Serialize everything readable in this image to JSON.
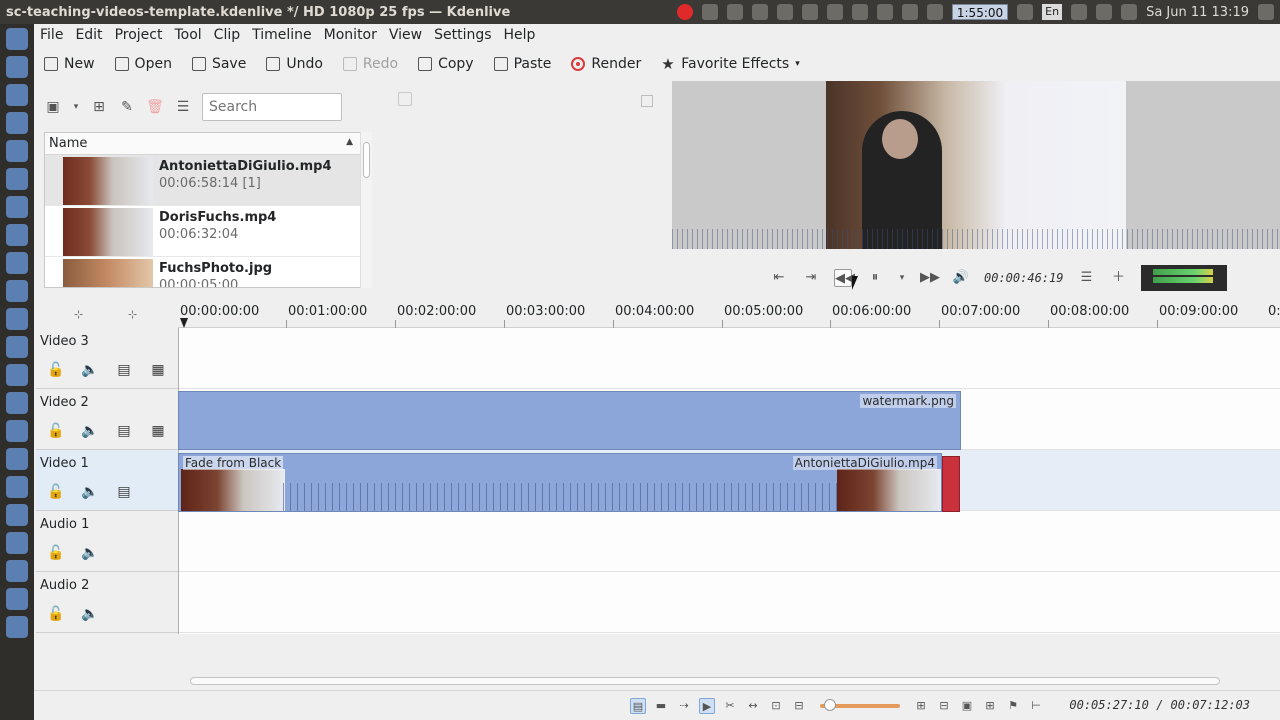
{
  "window": {
    "title": "sc-teaching-videos-template.kdenlive */ HD 1080p 25 fps — Kdenlive"
  },
  "system_tray": {
    "clock_box": "1:55:00",
    "keyboard_lang": "En",
    "datetime": "Sa Jun 11 13:19"
  },
  "menu": [
    "File",
    "Edit",
    "Project",
    "Tool",
    "Clip",
    "Timeline",
    "Monitor",
    "View",
    "Settings",
    "Help"
  ],
  "toolbar": {
    "new": "New",
    "open": "Open",
    "save": "Save",
    "undo": "Undo",
    "redo": "Redo",
    "copy": "Copy",
    "paste": "Paste",
    "render": "Render",
    "favorite_effects": "Favorite Effects"
  },
  "bin": {
    "search_placeholder": "Search",
    "column_name": "Name",
    "clips": [
      {
        "name": "AntoniettaDiGiulio.mp4",
        "duration": "00:06:58:14",
        "count": "[1]"
      },
      {
        "name": "DorisFuchs.mp4",
        "duration": "00:06:32:04",
        "count": ""
      },
      {
        "name": "FuchsPhoto.jpg",
        "duration": "00:00:05:00",
        "count": ""
      }
    ]
  },
  "monitor": {
    "timecode": "00:00:46:19"
  },
  "ruler": {
    "ticks": [
      "00:00:00:00",
      "00:01:00:00",
      "00:02:00:00",
      "00:03:00:00",
      "00:04:00:00",
      "00:05:00:00",
      "00:06:00:00",
      "00:07:00:00",
      "00:08:00:00",
      "00:09:00:00"
    ],
    "overflow_label": "0:"
  },
  "tracks": [
    {
      "name": "Video 3"
    },
    {
      "name": "Video 2"
    },
    {
      "name": "Video 1"
    },
    {
      "name": "Audio 1"
    },
    {
      "name": "Audio 2"
    }
  ],
  "timeline_clips": {
    "watermark": "watermark.png",
    "transition": "Fade from Black",
    "main": "AntoniettaDiGiulio.mp4"
  },
  "status": {
    "time": "00:05:27:10 / 00:07:12:03"
  }
}
